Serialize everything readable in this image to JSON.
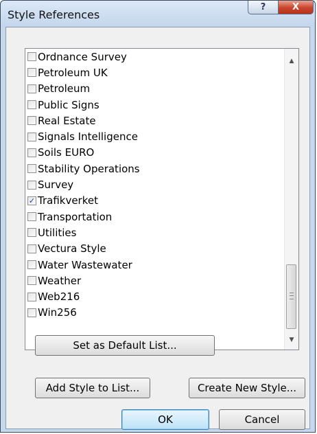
{
  "window": {
    "title": "Style References",
    "help_glyph": "?",
    "close_glyph": "X"
  },
  "list": {
    "items": [
      {
        "label": "Ordnance Survey",
        "checked": false
      },
      {
        "label": "Petroleum UK",
        "checked": false
      },
      {
        "label": "Petroleum",
        "checked": false
      },
      {
        "label": "Public Signs",
        "checked": false
      },
      {
        "label": "Real Estate",
        "checked": false
      },
      {
        "label": "Signals Intelligence",
        "checked": false
      },
      {
        "label": "Soils EURO",
        "checked": false
      },
      {
        "label": "Stability Operations",
        "checked": false
      },
      {
        "label": "Survey",
        "checked": false
      },
      {
        "label": "Trafikverket",
        "checked": true
      },
      {
        "label": "Transportation",
        "checked": false
      },
      {
        "label": "Utilities",
        "checked": false
      },
      {
        "label": "Vectura Style",
        "checked": false
      },
      {
        "label": "Water Wastewater",
        "checked": false
      },
      {
        "label": "Weather",
        "checked": false
      },
      {
        "label": "Web216",
        "checked": false
      },
      {
        "label": "Win256",
        "checked": false
      }
    ],
    "scroll_up_glyph": "▲",
    "scroll_down_glyph": "▼"
  },
  "buttons": {
    "set_default": "Set as Default List...",
    "add_style": "Add Style to List...",
    "create_style": "Create New Style...",
    "ok": "OK",
    "cancel": "Cancel"
  },
  "colors": {
    "title_bar": "#c4d6ec",
    "close_button": "#c9452c",
    "ok_button": "#bde3f8",
    "check_mark": "#1d3c9e"
  }
}
